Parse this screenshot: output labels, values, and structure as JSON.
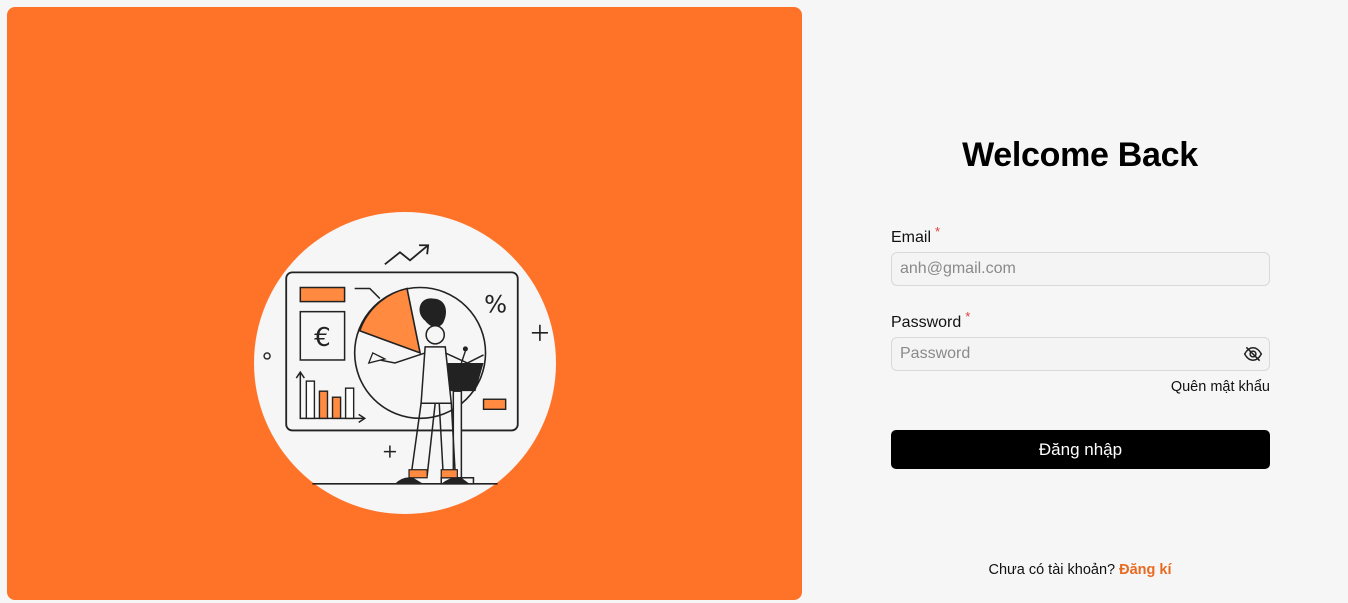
{
  "colors": {
    "accent": "#ff7329",
    "background": "#f6f6f6",
    "button": "#000000",
    "link": "#e86a21",
    "required": "#e23b3b"
  },
  "hero": {
    "illustration": "presenter-with-charts-illustration",
    "euro_symbol": "€",
    "percent_symbol": "%"
  },
  "form": {
    "title": "Welcome Back",
    "email": {
      "label": "Email",
      "required_mark": "*",
      "placeholder": "anh@gmail.com",
      "value": ""
    },
    "password": {
      "label": "Password",
      "required_mark": "*",
      "placeholder": "Password",
      "value": "",
      "toggle_icon": "eye-off-icon"
    },
    "forgot_label": "Quên mật khẩu",
    "submit_label": "Đăng nhập",
    "signup_prompt": "Chưa có tài khoản?",
    "signup_link": "Đăng kí"
  }
}
